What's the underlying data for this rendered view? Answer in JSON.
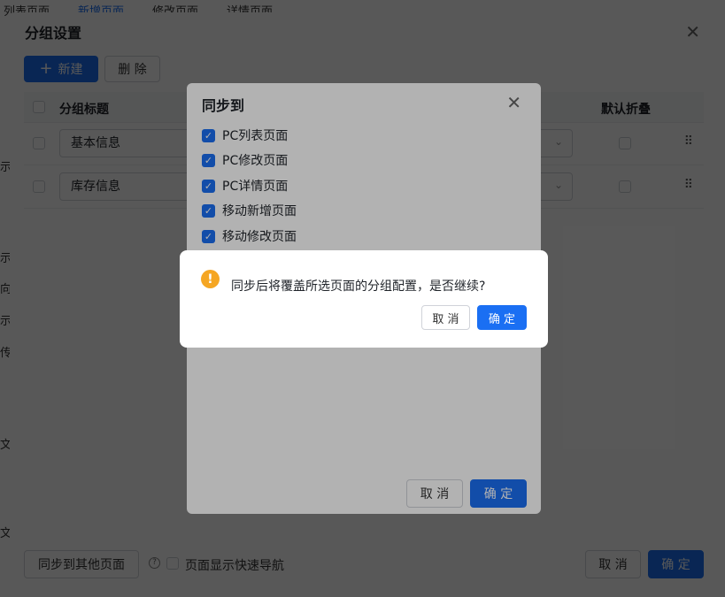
{
  "bg": {
    "tabs": [
      "列表页面",
      "新增页面",
      "修改页面",
      "详情页面"
    ],
    "side_fragments": [
      "示",
      "示",
      "向",
      "示",
      "传",
      "文",
      "文"
    ]
  },
  "group_modal": {
    "title": "分组设置",
    "new_label": "新建",
    "delete_label": "删 除",
    "columns": {
      "title": "分组标题",
      "default_collapse": "默认折叠"
    },
    "rows": [
      {
        "title": "基本信息"
      },
      {
        "title": "库存信息"
      }
    ],
    "sync_button": "同步到其他页面",
    "nav_checkbox_label": "页面显示快速导航",
    "cancel_label": "取 消",
    "ok_label": "确 定"
  },
  "sync_modal": {
    "title": "同步到",
    "options": [
      {
        "label": "PC列表页面",
        "checked": true
      },
      {
        "label": "PC修改页面",
        "checked": true
      },
      {
        "label": "PC详情页面",
        "checked": true
      },
      {
        "label": "移动新增页面",
        "checked": true
      },
      {
        "label": "移动修改页面",
        "checked": true
      }
    ],
    "cancel_label": "取 消",
    "ok_label": "确 定"
  },
  "confirm": {
    "message": "同步后将覆盖所选页面的分组配置，是否继续?",
    "cancel_label": "取 消",
    "ok_label": "确 定"
  },
  "colors": {
    "primary": "#1a6ff3",
    "warning": "#f5a623"
  },
  "icons": {
    "close": "close-icon",
    "warning": "warning-icon",
    "plus": "plus-icon",
    "drag": "drag-handle-icon"
  }
}
